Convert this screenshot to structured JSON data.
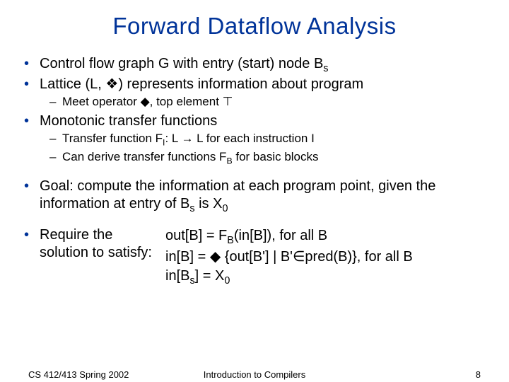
{
  "title": "Forward Dataflow Analysis",
  "bullets": {
    "b1_pre": "Control flow graph G with entry (start) node B",
    "b1_sub": "s",
    "b2_pre": "Lattice (L, ",
    "b2_sym": "❖",
    "b2_post": ") represents information about program",
    "b2a_pre": "Meet operator ",
    "b2a_sym1": "◆",
    "b2a_mid": ", top element ",
    "b2a_sym2": "⊤",
    "b3": "Monotonic transfer functions",
    "b3a_pre": "Transfer function F",
    "b3a_subI": "I",
    "b3a_mid": ": L ",
    "b3a_arrow": "→",
    "b3a_post": " L for each instruction I",
    "b3b_pre": "Can derive transfer functions F",
    "b3b_subB": "B",
    "b3b_post": " for basic blocks",
    "b4_pre": "Goal: compute the information at each program point, given the information at entry of B",
    "b4_sub": "s",
    "b4_mid": " is X",
    "b4_sub2": "0",
    "b5": "Require the solution to satisfy:"
  },
  "eq": {
    "l1_a": "out[B] = F",
    "l1_subB": "B",
    "l1_b": "(in[B]), for all B",
    "l2_a": "in[B] = ",
    "l2_sym": "◆",
    "l2_b": " {out[B'] | B'",
    "l2_in": "∈",
    "l2_c": "pred(B)}, for all B",
    "l3_a": "in[B",
    "l3_sub": "s",
    "l3_b": "]  = X",
    "l3_sub2": "0"
  },
  "footer": {
    "left": "CS 412/413   Spring 2002",
    "center": "Introduction to Compilers",
    "right": "8"
  }
}
